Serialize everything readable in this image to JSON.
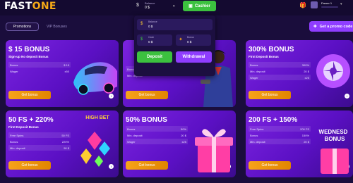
{
  "header": {
    "logo_main": "FAST",
    "logo_accent": "ONE",
    "balance_label": "Balance",
    "balance_value": "0 $",
    "cashier_label": "Cashier",
    "username": "Faroer 1",
    "user_progress": 0,
    "icons": [
      "dollar-icon",
      "wallet-icon",
      "chevron-down-icon",
      "gift-icon",
      "avatar",
      "plus-icon"
    ]
  },
  "tabs": {
    "promotions": "Promotions",
    "vip": "VIP Bonuses"
  },
  "promo_button": "Get a promo code",
  "dropdown": {
    "balance_label": "Balance",
    "balance_value": "0 $",
    "cash_label": "Cash",
    "cash_value": "0 $",
    "bonus_label": "Bonus",
    "bonus_value": "0 $",
    "deposit_label": "Deposit",
    "withdrawal_label": "Withdrawal"
  },
  "cards": [
    {
      "title": "$ 15 BONUS",
      "subtitle": "Sign-up No deposit Bonus",
      "rows": [
        {
          "k": "Bonus",
          "v": "$ 15"
        },
        {
          "k": "Wager",
          "v": "x50"
        }
      ],
      "button": "Get bonus"
    },
    {
      "title": "",
      "subtitle": "",
      "rows": [
        {
          "k": "Bonus",
          "v": ""
        },
        {
          "k": "Min. deposit",
          "v": ""
        }
      ],
      "button": "Get bonus"
    },
    {
      "title": "300% BONUS",
      "subtitle": "First Deposit Bonus",
      "rows": [
        {
          "k": "Bonus",
          "v": "300%"
        },
        {
          "k": "Min. deposit",
          "v": "20 $"
        },
        {
          "k": "Wager",
          "v": "x25"
        }
      ],
      "button": "Get bonus"
    },
    {
      "title": "50 FS + 220%",
      "subtitle": "First Deposit Bonus",
      "rows": [
        {
          "k": "Free Spins",
          "v": "50 FS"
        },
        {
          "k": "Bonus",
          "v": "220%"
        },
        {
          "k": "Min. deposit",
          "v": "50 $"
        }
      ],
      "button": "Get bonus"
    },
    {
      "title": "50% BONUS",
      "subtitle": "",
      "rows": [
        {
          "k": "Bonus",
          "v": "50%"
        },
        {
          "k": "Min. deposit",
          "v": "20 $"
        },
        {
          "k": "Wager",
          "v": "x25"
        }
      ],
      "button": "Get bonus"
    },
    {
      "title": "200 FS + 150%",
      "subtitle": "",
      "rows": [
        {
          "k": "Free Spins",
          "v": "200 FS"
        },
        {
          "k": "Bonus",
          "v": "150%"
        },
        {
          "k": "Min. deposit",
          "v": "20 $"
        }
      ],
      "button": "Get bonus"
    }
  ],
  "art_text": {
    "high_bet": "HIGH BET",
    "wednesday_line1": "WEDNESD",
    "wednesday_line2": "BONUS"
  },
  "colors": {
    "accent": "#f6a917",
    "green": "#3cc13f",
    "purple": "#8f3dff",
    "background": "#1a0d3c"
  }
}
